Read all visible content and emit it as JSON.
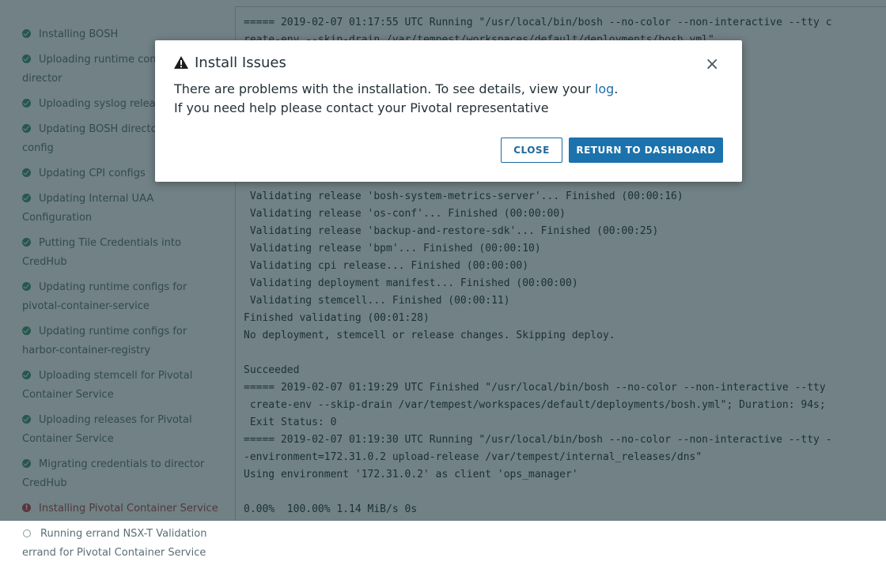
{
  "sidebar": {
    "steps": [
      {
        "label": "Installing BOSH",
        "status": "done"
      },
      {
        "label": "Uploading runtime config to the director",
        "status": "done"
      },
      {
        "label": "Uploading syslog release",
        "status": "done"
      },
      {
        "label": "Updating BOSH director DNS config",
        "status": "done"
      },
      {
        "label": "Updating CPI configs",
        "status": "done"
      },
      {
        "label": "Updating Internal UAA Configuration",
        "status": "done"
      },
      {
        "label": "Putting Tile Credentials into CredHub",
        "status": "done"
      },
      {
        "label": "Updating runtime configs for pivotal-container-service",
        "status": "done"
      },
      {
        "label": "Updating runtime configs for harbor-container-registry",
        "status": "done"
      },
      {
        "label": "Uploading stemcell for Pivotal Container Service",
        "status": "done"
      },
      {
        "label": "Uploading releases for Pivotal Container Service",
        "status": "done"
      },
      {
        "label": "Migrating credentials to director CredHub",
        "status": "done"
      },
      {
        "label": "Installing Pivotal Container Service",
        "status": "error"
      },
      {
        "label": "Running errand NSX-T Validation errand for Pivotal Container Service",
        "status": "pending"
      }
    ]
  },
  "log": {
    "lines": [
      "===== 2019-02-07 01:17:55 UTC Running \"/usr/local/bin/bosh --no-color --non-interactive --tty c",
      "reate-env --skip-drain /var/tempest/workspaces/default/deployments/bosh.yml\"",
      "",
      "",
      "",
      "",
      "",
      "",
      "",
      "",
      " Validating release 'bosh-system-metrics-server'... Finished (00:00:16)",
      " Validating release 'os-conf'... Finished (00:00:00)",
      " Validating release 'backup-and-restore-sdk'... Finished (00:00:25)",
      " Validating release 'bpm'... Finished (00:00:10)",
      " Validating cpi release... Finished (00:00:00)",
      " Validating deployment manifest... Finished (00:00:00)",
      " Validating stemcell... Finished (00:00:11)",
      "Finished validating (00:01:28)",
      "No deployment, stemcell or release changes. Skipping deploy.",
      "",
      "Succeeded",
      "===== 2019-02-07 01:19:29 UTC Finished \"/usr/local/bin/bosh --no-color --non-interactive --tty",
      " create-env --skip-drain /var/tempest/workspaces/default/deployments/bosh.yml\"; Duration: 94s;",
      " Exit Status: 0",
      "===== 2019-02-07 01:19:30 UTC Running \"/usr/local/bin/bosh --no-color --non-interactive --tty -",
      "-environment=172.31.0.2 upload-release /var/tempest/internal_releases/dns\"",
      "Using environment '172.31.0.2' as client 'ops_manager'",
      "",
      "0.00%  100.00% 1.14 MiB/s 0s"
    ]
  },
  "modal": {
    "title": "Install Issues",
    "warning_icon": "warning-triangle-icon",
    "close_icon": "×",
    "body_line1_prefix": "There are problems with the installation. To see details, view your ",
    "body_line1_link": "log",
    "body_line1_suffix": ".",
    "body_line2": "If you need help please contact your Pivotal representative",
    "close_button": "CLOSE",
    "return_button": "RETURN TO DASHBOARD"
  }
}
